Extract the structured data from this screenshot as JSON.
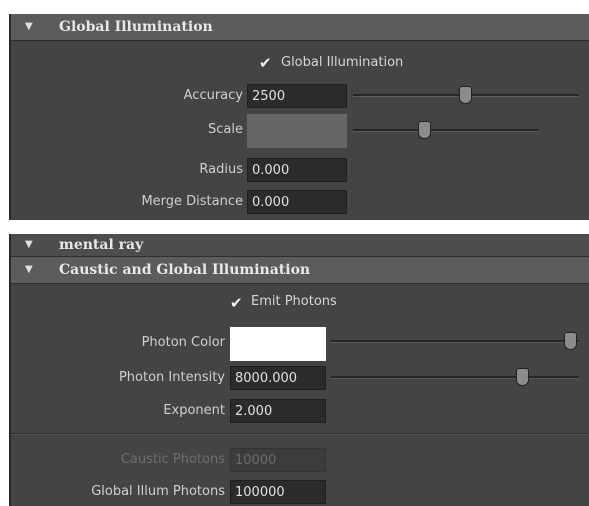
{
  "top_panel": {
    "header": {
      "title": "Global Illumination"
    },
    "gi_checkbox": {
      "label": "Global Illumination",
      "checked": true
    },
    "accuracy": {
      "label": "Accuracy",
      "value": "2500"
    },
    "scale": {
      "label": "Scale",
      "color": "#666666"
    },
    "radius": {
      "label": "Radius",
      "value": "0.000"
    },
    "merge_distance": {
      "label": "Merge Distance",
      "value": "0.000"
    }
  },
  "bottom_panel": {
    "header_mental_ray": {
      "title": "mental ray"
    },
    "header_caustic": {
      "title": "Caustic and Global Illumination"
    },
    "emit_photons": {
      "label": "Emit Photons",
      "checked": true
    },
    "photon_color": {
      "label": "Photon Color",
      "color": "#ffffff"
    },
    "photon_intensity": {
      "label": "Photon Intensity",
      "value": "8000.000"
    },
    "exponent": {
      "label": "Exponent",
      "value": "2.000"
    },
    "caustic_photons": {
      "label": "Caustic Photons",
      "value": "10000",
      "disabled": true
    },
    "global_illum_photons": {
      "label": "Global Illum Photons",
      "value": "100000"
    }
  }
}
